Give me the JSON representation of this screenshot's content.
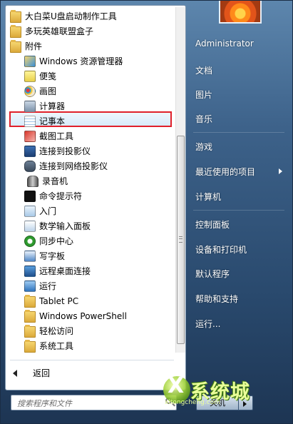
{
  "programs": [
    {
      "label": "大白菜U盘启动制作工具",
      "icon": "folder-icon",
      "indent": 0
    },
    {
      "label": "多玩英雄联盟盒子",
      "icon": "folder-icon",
      "indent": 0
    },
    {
      "label": "附件",
      "icon": "folder-icon",
      "indent": 0
    },
    {
      "label": "Windows 资源管理器",
      "icon": "explorer-icon",
      "indent": 1
    },
    {
      "label": "便笺",
      "icon": "sticky-notes-icon",
      "indent": 1
    },
    {
      "label": "画图",
      "icon": "paint-icon",
      "indent": 1
    },
    {
      "label": "计算器",
      "icon": "calculator-icon",
      "indent": 1
    },
    {
      "label": "记事本",
      "icon": "notepad-icon",
      "indent": 1,
      "selected": true
    },
    {
      "label": "截图工具",
      "icon": "snipping-tool-icon",
      "indent": 1
    },
    {
      "label": "连接到投影仪",
      "icon": "projector-icon",
      "indent": 1
    },
    {
      "label": "连接到网络投影仪",
      "icon": "network-projector-icon",
      "indent": 1
    },
    {
      "label": "录音机",
      "icon": "microphone-icon",
      "indent": 1
    },
    {
      "label": "命令提示符",
      "icon": "command-prompt-icon",
      "indent": 1
    },
    {
      "label": "入门",
      "icon": "getting-started-icon",
      "indent": 1
    },
    {
      "label": "数学输入面板",
      "icon": "math-input-icon",
      "indent": 1
    },
    {
      "label": "同步中心",
      "icon": "sync-center-icon",
      "indent": 1
    },
    {
      "label": "写字板",
      "icon": "wordpad-icon",
      "indent": 1
    },
    {
      "label": "远程桌面连接",
      "icon": "remote-desktop-icon",
      "indent": 1
    },
    {
      "label": "运行",
      "icon": "run-icon",
      "indent": 1
    },
    {
      "label": "Tablet PC",
      "icon": "folder-icon",
      "indent": 1
    },
    {
      "label": "Windows PowerShell",
      "icon": "folder-icon",
      "indent": 1
    },
    {
      "label": "轻松访问",
      "icon": "folder-icon",
      "indent": 1
    },
    {
      "label": "系统工具",
      "icon": "folder-icon",
      "indent": 1
    }
  ],
  "back_label": "返回",
  "search_placeholder": "搜索程序和文件",
  "right_menu": {
    "user": "Administrator",
    "items": [
      "文档",
      "图片",
      "音乐",
      "游戏",
      "最近使用的项目",
      "计算机",
      "控制面板",
      "设备和打印机",
      "默认程序",
      "帮助和支持",
      "运行..."
    ]
  },
  "shutdown_label": "关机",
  "watermark": {
    "main": "系统城",
    "sub": "xitongcheng.com"
  },
  "colors": {
    "selection_outline": "#e0202a",
    "menu_frame": "#2b4a6e",
    "highlight": "#d8ebfa"
  }
}
